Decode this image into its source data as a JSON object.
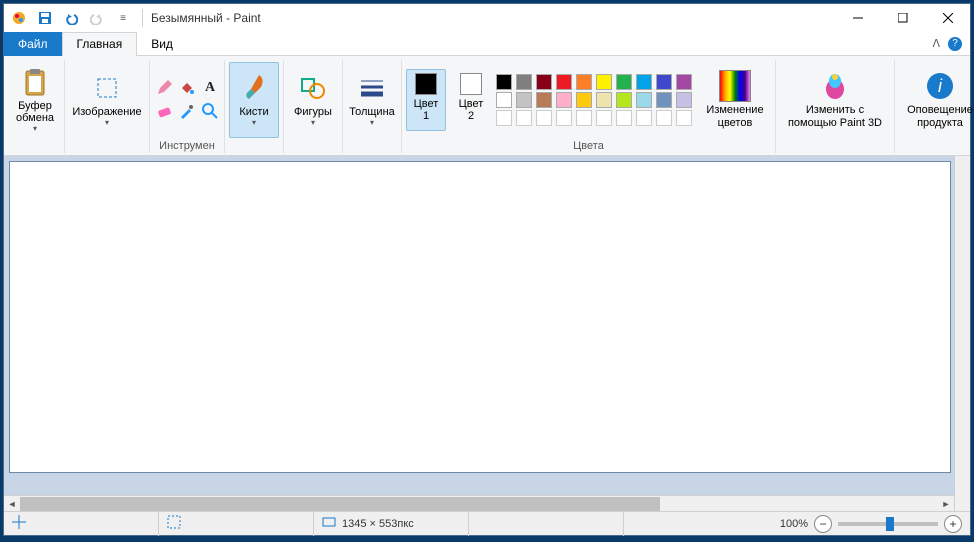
{
  "title": "Безымянный - Paint",
  "tabs": {
    "file": "Файл",
    "home": "Главная",
    "view": "Вид"
  },
  "groups": {
    "clipboard": "Буфер\nобмена",
    "image": "Изображение",
    "tools": "Инструмен",
    "brushes": "Кисти",
    "shapes": "Фигуры",
    "thickness": "Толщина",
    "color1": "Цвет\n1",
    "color2": "Цвет\n2",
    "edit_colors": "Изменение\nцветов",
    "colors_label": "Цвета",
    "paint3d": "Изменить с\nпомощью Paint 3D",
    "alert": "Оповещение\nпродукта"
  },
  "palette_row1": [
    "#000000",
    "#7f7f7f",
    "#880015",
    "#ed1c24",
    "#ff7f27",
    "#fff200",
    "#22b14c",
    "#00a2e8",
    "#3f48cc",
    "#a349a4"
  ],
  "palette_row2": [
    "#ffffff",
    "#c3c3c3",
    "#b97a57",
    "#ffaec9",
    "#ffc90e",
    "#efe4b0",
    "#b5e61d",
    "#99d9ea",
    "#7092be",
    "#c8bfe7"
  ],
  "color1_value": "#000000",
  "color2_value": "#ffffff",
  "status": {
    "dimensions": "1345 × 553пкс",
    "zoom": "100%"
  }
}
